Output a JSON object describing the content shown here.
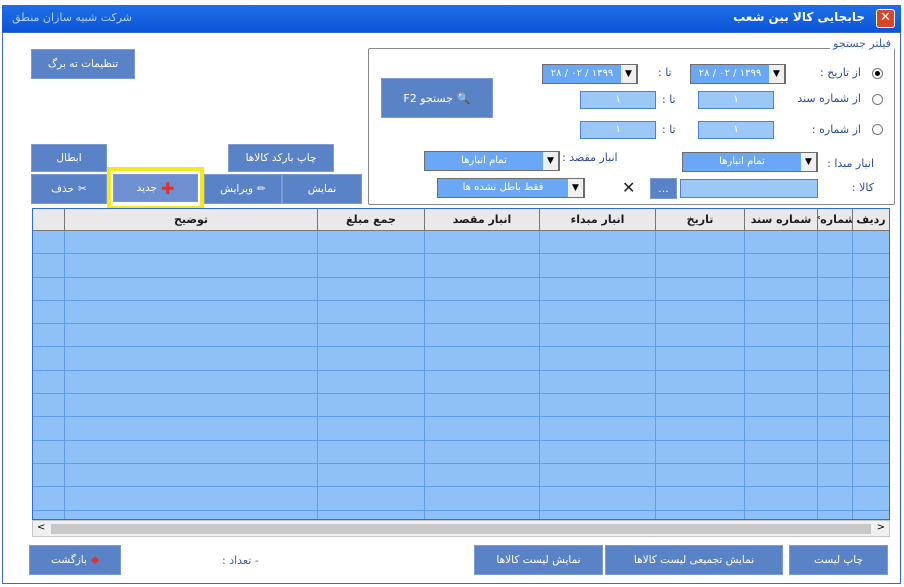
{
  "window": {
    "title": "جابجایی کالا بین شعب",
    "company": "شرکت شبیه سازان منطق"
  },
  "filter": {
    "legend": "فیلتر جستجو",
    "from_date_label": "از تاریخ :",
    "from_date_value": "۱۳۹۹ / ۰۲ / ۲۸",
    "to_label": "تا :",
    "to_date_value": "۱۳۹۹ / ۰۲ / ۲۸",
    "from_doc_label": "از شماره سند",
    "from_doc_value": "۱",
    "to_doc_value": "۱",
    "from_num_label": "از شماره :",
    "from_num_value": "۱",
    "to_num_value": "۱",
    "src_warehouse_label": "انبار مبدا :",
    "src_warehouse_value": "تمام انبارها",
    "dst_warehouse_label": "انبار مقصد :",
    "dst_warehouse_value": "تمام انبارها",
    "item_label": "کالا :",
    "item_value": "",
    "status_value": "فقط باطل نشده ها",
    "browse_label": "...",
    "search_button": "جستجو F2"
  },
  "toolbar": {
    "settings": "تنظیمات ته برگ",
    "print_barcode": "چاپ بارکد کالاها",
    "cancel": "ابطال",
    "show": "نمایش",
    "edit": "ویرایش",
    "new": "جدید",
    "delete": "حذف"
  },
  "table": {
    "columns": [
      "ردیف",
      "شماره*",
      "شماره سند",
      "تاریخ",
      "انبار مبداء",
      "انبار مقصد",
      "جمع مبلغ",
      "توضیح"
    ],
    "rows": [
      [],
      [],
      [],
      [],
      [],
      [],
      [],
      [],
      [],
      [],
      [],
      [],
      []
    ]
  },
  "footer": {
    "print_list": "چاپ لیست",
    "show_summary": "نمایش تجمیعی لیست کالاها",
    "show_items": "نمایش لیست کالاها",
    "count_label": "تعداد :",
    "count_value": "-",
    "back": "بازگشت"
  },
  "icons": {
    "close": "close-icon",
    "search": "search-icon",
    "new": "plus-icon",
    "edit": "pencil-icon",
    "delete": "x-icon",
    "back": "back-icon",
    "clear": "clear-x-icon"
  },
  "colors": {
    "titlebar": "#0b55d8",
    "button": "#5a82c6",
    "grid": "#8fc0f6",
    "highlight": "#f5e81c"
  }
}
